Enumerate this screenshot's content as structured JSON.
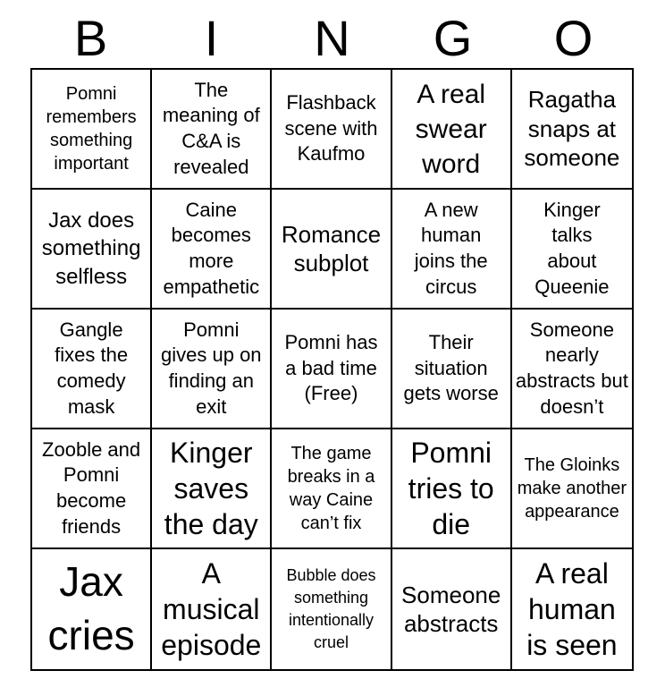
{
  "title_letters": [
    "B",
    "I",
    "N",
    "G",
    "O"
  ],
  "cells": [
    "Pomni remembers something important",
    "The meaning of C&A is revealed",
    "Flashback scene with Kaufmo",
    "A real swear word",
    "Ragatha snaps at someone",
    "Jax does something selfless",
    "Caine becomes more empathetic",
    "Romance subplot",
    "A new human joins the circus",
    "Kinger talks about Queenie",
    "Gangle fixes the comedy mask",
    "Pomni gives up on finding an exit",
    "Pomni has a bad time (Free)",
    "Their situation gets worse",
    "Someone nearly abstracts but doesn’t",
    "Zooble and Pomni become friends",
    "Kinger saves the day",
    "The game breaks in a way Caine can’t fix",
    "Pomni tries to die",
    "The Gloinks make another appearance",
    "Jax cries",
    "A musical episode",
    "Bubble does something intentionally cruel",
    "Someone abstracts",
    "A real human is seen"
  ],
  "free_space": "Pomni has a bad time (Free)"
}
